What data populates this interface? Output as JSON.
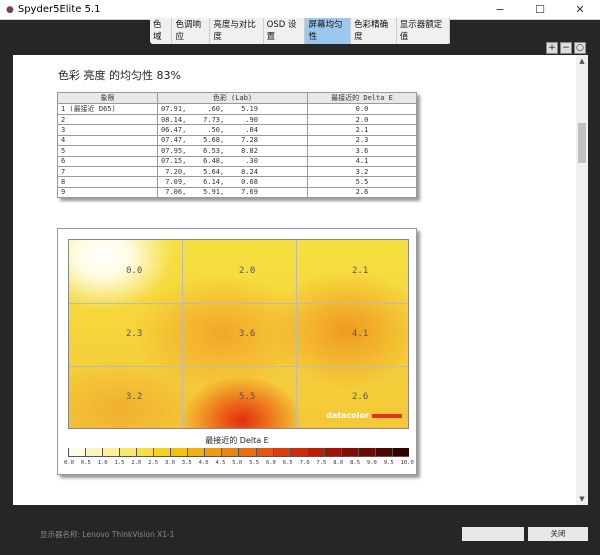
{
  "window": {
    "title": "Spyder5Elite 5.1",
    "minimize": "−",
    "maximize": "☐",
    "close": "✕"
  },
  "tabs": [
    {
      "label": "色域"
    },
    {
      "label": "色调响应"
    },
    {
      "label": "亮度与对比度"
    },
    {
      "label": "OSD 设置"
    },
    {
      "label": "屏幕均匀性",
      "active": true
    },
    {
      "label": "色彩精确度"
    },
    {
      "label": "显示器额定值"
    }
  ],
  "zoom": {
    "in": "+",
    "out": "−",
    "fit": "○"
  },
  "report": {
    "heading": "色彩 亮度 的均匀性 83%",
    "table": {
      "headers": [
        "象限",
        "色彩 (Lab)",
        "最接近的 Delta E"
      ],
      "rows": [
        [
          "1 (最接近 D65)",
          "07.91,     .60,    5.19",
          "0.0"
        ],
        [
          "2",
          "08.14,    7.73,     .90",
          "2.0"
        ],
        [
          "3",
          "06.47,     .50,     .04",
          "2.1"
        ],
        [
          "4",
          "07.47,    5.68,    7.28",
          "2.3"
        ],
        [
          "5",
          "07.95,    6.53,    8.82",
          "3.6"
        ],
        [
          "6",
          "07.15,    6.48,     .30",
          "4.1"
        ],
        [
          "7",
          " 7.20,    5.64,    8.24",
          "3.2"
        ],
        [
          "8",
          " 7.09,    6.14,    0.68",
          "5.5"
        ],
        [
          "9",
          " 7.06,    5.91,    7.69",
          "2.6"
        ]
      ]
    },
    "heatmap": {
      "cells": [
        "0.0",
        "2.0",
        "2.1",
        "2.3",
        "3.6",
        "4.1",
        "3.2",
        "5.5",
        "2.6"
      ],
      "logo": "datacolor",
      "legend_title": "最接近的 Delta E",
      "ticks": [
        "0.0",
        "0.5",
        "1.0",
        "1.5",
        "2.0",
        "2.5",
        "3.0",
        "3.5",
        "4.0",
        "4.5",
        "5.0",
        "5.5",
        "6.0",
        "6.5",
        "7.0",
        "7.5",
        "8.0",
        "8.5",
        "9.0",
        "9.5",
        "10.0"
      ],
      "scale_colors": [
        "#fffbe6",
        "#fdf5c0",
        "#fbef9a",
        "#f8e870",
        "#f6df40",
        "#f4d21e",
        "#f2c310",
        "#f0b010",
        "#ee9c10",
        "#ec8510",
        "#ea6e10",
        "#e85510",
        "#e03c10",
        "#cf2a0c",
        "#b81e08",
        "#9e1405",
        "#850e04",
        "#6a0a03",
        "#4e0602",
        "#300302"
      ]
    }
  },
  "footer": {
    "monitor_name": "显示器名称: Lenovo ThinkVision X1-1",
    "button_blank": "",
    "close_button": "关闭"
  }
}
